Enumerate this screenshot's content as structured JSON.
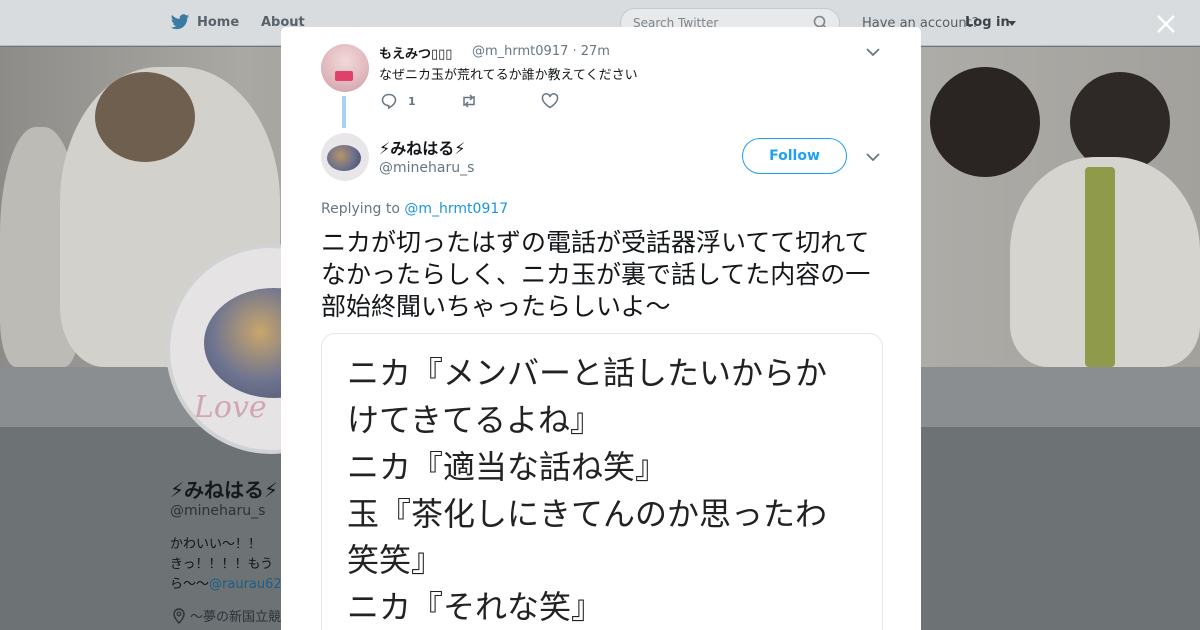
{
  "topnav": {
    "home_label": "Home",
    "about_label": "About",
    "search_placeholder": "Search Twitter",
    "account_prompt": "Have an account?",
    "login_label": "Log in"
  },
  "profile": {
    "name": "⚡みねはる⚡",
    "handle": "@mineharu_s",
    "bio_line1": "かわいい〜！！",
    "bio_line2": "きっ！！！！もう",
    "bio_line3": "ら〜〜",
    "bio_link": "@raurau62",
    "location": "〜夢の新国立競",
    "avatar_text": "Love"
  },
  "thread_tweet": {
    "name": "もえみつ▯▯▯",
    "handle_time": "@m_hrmt0917 · 27m",
    "text": "なぜニカ玉が荒れてるか誰か教えてください",
    "reply_count": "1"
  },
  "main_tweet": {
    "name": "⚡みねはる⚡",
    "handle": "@mineharu_s",
    "follow_label": "Follow",
    "replying_prefix": "Replying to",
    "replying_to": "@m_hrmt0917",
    "text": "ニカが切ったはずの電話が受話器浮いてて切れてなかったらしく、ニカ玉が裏で話してた内容の一部始終聞いちゃったらしいよ〜",
    "image_lines": [
      "ニカ『メンバーと話したいからか",
      "けてきてるよね』",
      "ニカ『適当な話ね笑』",
      "玉『茶化しにきてんのか思ったわ",
      "笑笑』",
      "ニカ『それな笑』"
    ]
  },
  "colors": {
    "accent": "#1da1f2",
    "link": "#1b95e0",
    "muted": "#657786",
    "thread_line": "#a7d3f2"
  },
  "icons": [
    "twitter-bird-icon",
    "search-icon",
    "close-icon",
    "chevron-down-icon",
    "reply-icon",
    "retweet-icon",
    "like-icon",
    "location-icon"
  ]
}
